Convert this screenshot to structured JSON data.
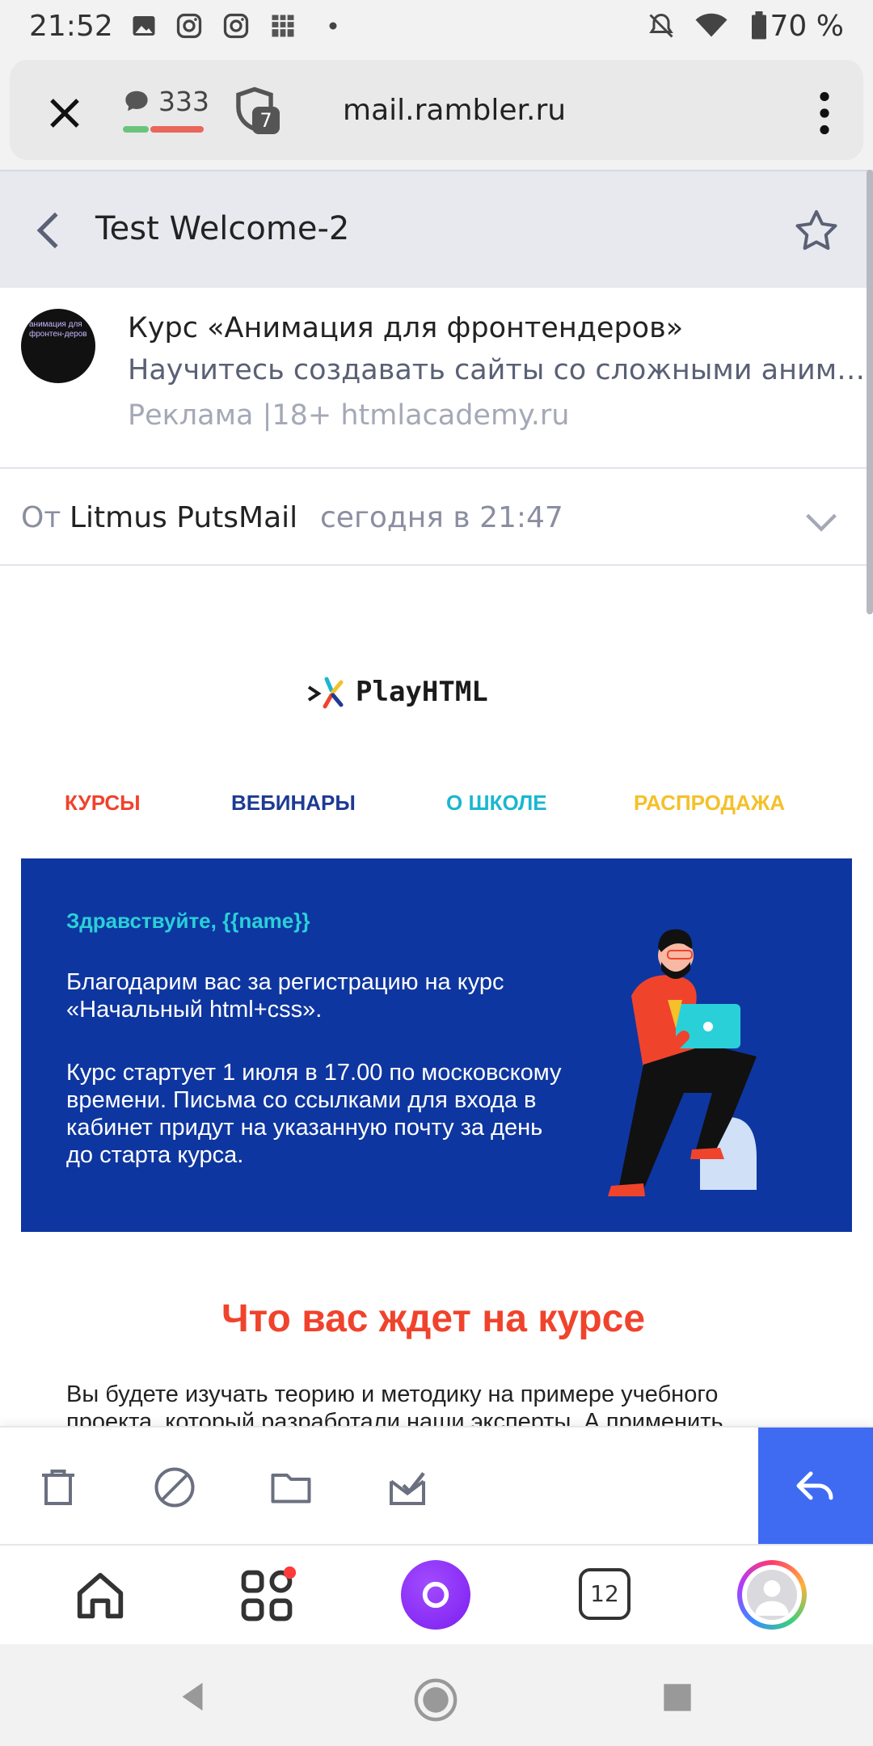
{
  "status_bar": {
    "time": "21:52",
    "battery": "70 %"
  },
  "browser": {
    "url": "mail.rambler.ru",
    "messages_count": "333",
    "shield_count": "7"
  },
  "mail_header": {
    "subject": "Test Welcome-2"
  },
  "ad": {
    "avatar_text": "анимация для фронтен-деров",
    "title": "Курс «Анимация для фронтендеров»",
    "description": "Научитесь создавать сайты со сложными анимациями",
    "meta": "Реклама |18+ htmlacademy.ru"
  },
  "from": {
    "label": "От",
    "name": "Litmus PutsMail",
    "date": "сегодня в 21:47"
  },
  "email": {
    "logo_text": "PlayHTML",
    "nav": [
      {
        "label": "КУРСЫ",
        "color": "#f0432c"
      },
      {
        "label": "ВЕБИНАРЫ",
        "color": "#1d3a94"
      },
      {
        "label": "О ШКОЛЕ",
        "color": "#19b7cf"
      },
      {
        "label": "РАСПРОДАЖА",
        "color": "#f5c02a"
      }
    ],
    "hero": {
      "greeting": "Здравствуйте, {{name}}",
      "paragraph1": "Благодарим вас за регистрацию на курс «Начальный html+css».",
      "paragraph2": "Курс стартует 1 июля в 17.00 по московскому времени. Письма со ссылками для входа в кабинет придут на указанную почту за день до старта курса."
    },
    "section_title": "Что вас ждет на курсе",
    "section_text": "Вы будете изучать теорию и методику на примере учебного проекта, который разработали наши эксперты. А применить"
  },
  "bottom_nav": {
    "tabs_count": "12"
  },
  "colors": {
    "reply_button": "#3f6bf2",
    "hero_bg": "#0e36a0",
    "accent_red": "#f0432c",
    "alice": "#8a2cf2"
  }
}
